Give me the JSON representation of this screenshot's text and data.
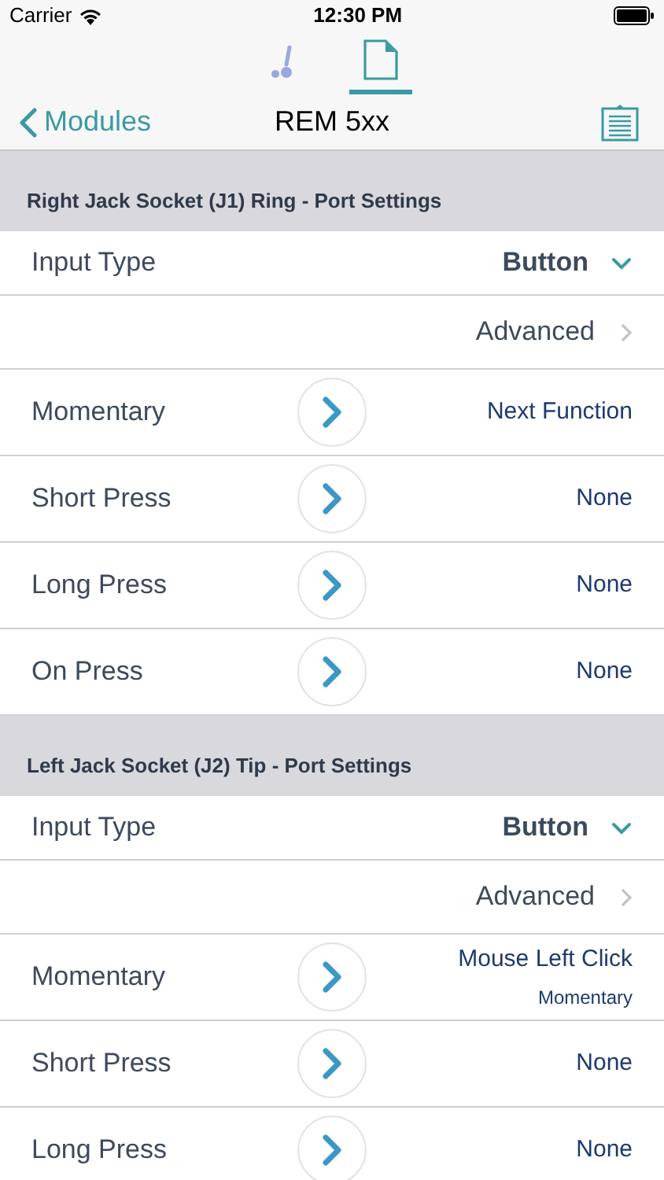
{
  "status_bar": {
    "carrier": "Carrier",
    "time": "12:30 PM"
  },
  "tabs": [
    {
      "kind": "chair",
      "selected": false
    },
    {
      "kind": "document",
      "selected": true
    }
  ],
  "nav": {
    "back": "Modules",
    "title": "REM 5xx"
  },
  "sections": [
    {
      "title": "Right Jack Socket (J1) Ring - Port Settings",
      "rows": [
        {
          "kind": "dropdown",
          "label": "Input Type",
          "value": "Button"
        },
        {
          "kind": "link",
          "value": "Advanced"
        },
        {
          "kind": "action",
          "label": "Momentary",
          "value": "Next Function"
        },
        {
          "kind": "action",
          "label": "Short Press",
          "value": "None"
        },
        {
          "kind": "action",
          "label": "Long Press",
          "value": "None"
        },
        {
          "kind": "action",
          "label": "On Press",
          "value": "None"
        }
      ]
    },
    {
      "title": "Left Jack Socket (J2) Tip - Port Settings",
      "rows": [
        {
          "kind": "dropdown",
          "label": "Input Type",
          "value": "Button"
        },
        {
          "kind": "link",
          "value": "Advanced"
        },
        {
          "kind": "action",
          "label": "Momentary",
          "value": "Mouse Left Click",
          "subtitle": "Momentary"
        },
        {
          "kind": "action",
          "label": "Short Press",
          "value": "None"
        },
        {
          "kind": "action",
          "label": "Long Press",
          "value": "None"
        }
      ]
    }
  ]
}
